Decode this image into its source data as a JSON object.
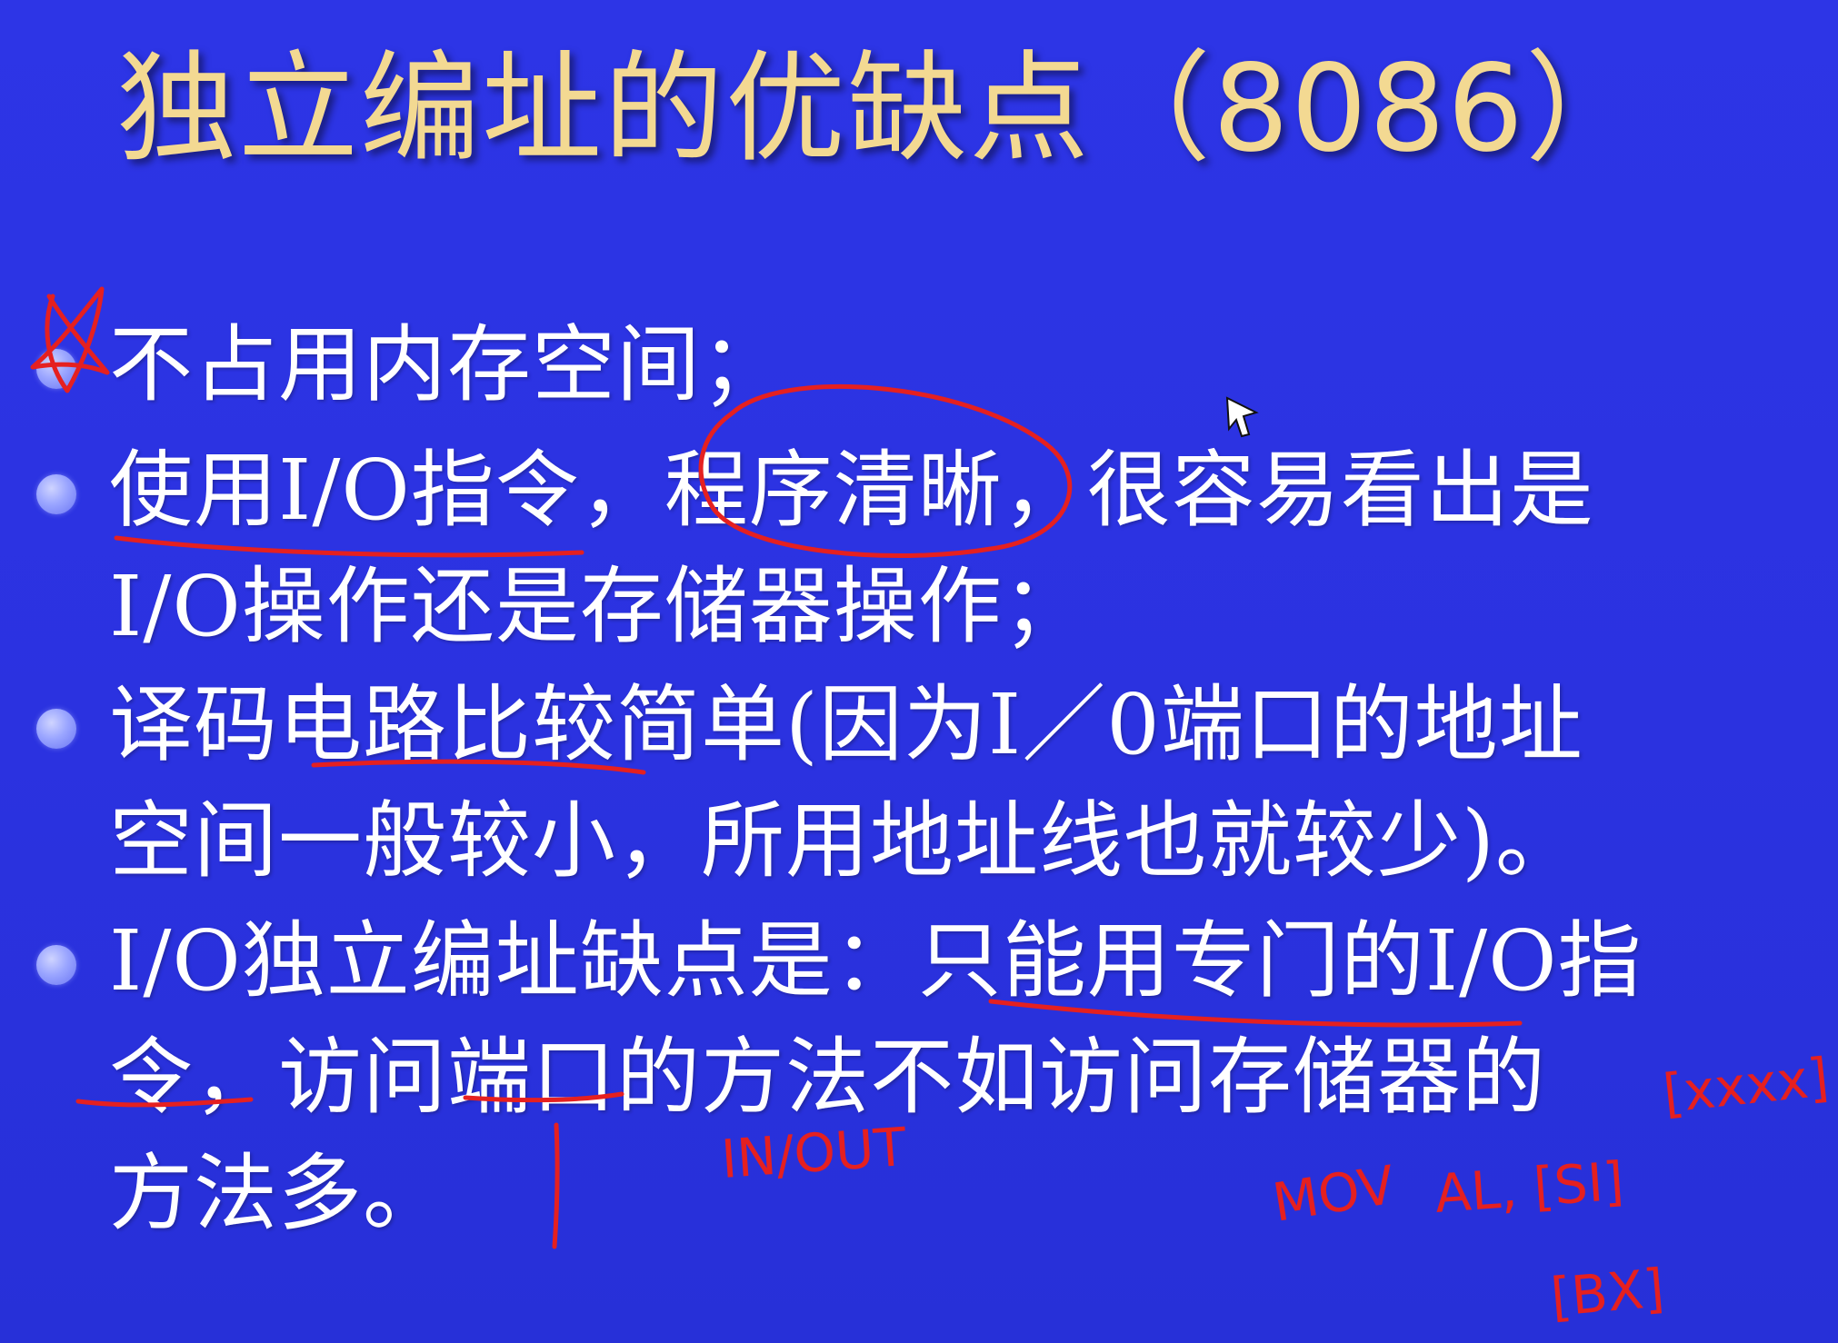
{
  "slide": {
    "title": "独立编址的优缺点（8086）",
    "bullets": [
      {
        "text": "不占用内存空间；"
      },
      {
        "text": "使用I/O指令，程序清晰，很容易看出是\nI/O操作还是存储器操作；"
      },
      {
        "text": "译码电路比较简单(因为I／0端口的地址\n空间一般较小，所用地址线也就较少)。"
      },
      {
        "text": "I/O独立编址缺点是：只能用专门的I/O指\n令，访问端口的方法不如访问存储器的\n方法多。"
      }
    ]
  },
  "annotations": {
    "in_out": "IN/OUT",
    "mov": "MOV",
    "al_si": "AL, [SI]",
    "bracket_top": "[xxxx]",
    "bx": "[BX]"
  },
  "colors": {
    "background": "#2b32e0",
    "title": "#f3d992",
    "text": "#ffffff",
    "bullet": "#aab3ff",
    "ink": "#e52020"
  }
}
